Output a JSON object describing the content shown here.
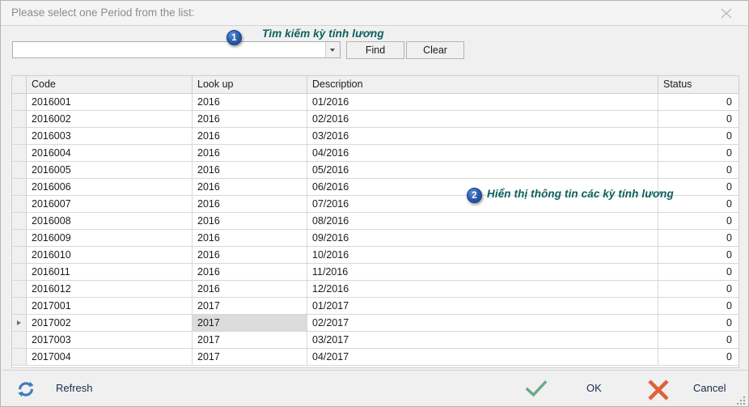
{
  "window": {
    "title": "Please select one Period from the list:",
    "close_icon": "close-icon"
  },
  "search": {
    "value": "",
    "placeholder": "",
    "dropdown_icon": "chevron-down-icon",
    "find_label": "Find",
    "clear_label": "Clear"
  },
  "annotations": [
    {
      "number": "1",
      "text": "Tìm kiếm kỳ tính lương"
    },
    {
      "number": "2",
      "text": "Hiển thị thông tin các kỳ tính lương"
    }
  ],
  "grid": {
    "columns": [
      "Code",
      "Look up",
      "Description",
      "Status"
    ],
    "current_row_index": 13,
    "rows": [
      {
        "code": "2016001",
        "lookup": "2016",
        "description": "01/2016",
        "status": "0"
      },
      {
        "code": "2016002",
        "lookup": "2016",
        "description": "02/2016",
        "status": "0"
      },
      {
        "code": "2016003",
        "lookup": "2016",
        "description": "03/2016",
        "status": "0"
      },
      {
        "code": "2016004",
        "lookup": "2016",
        "description": "04/2016",
        "status": "0"
      },
      {
        "code": "2016005",
        "lookup": "2016",
        "description": "05/2016",
        "status": "0"
      },
      {
        "code": "2016006",
        "lookup": "2016",
        "description": "06/2016",
        "status": "0"
      },
      {
        "code": "2016007",
        "lookup": "2016",
        "description": "07/2016",
        "status": "0"
      },
      {
        "code": "2016008",
        "lookup": "2016",
        "description": "08/2016",
        "status": "0"
      },
      {
        "code": "2016009",
        "lookup": "2016",
        "description": "09/2016",
        "status": "0"
      },
      {
        "code": "2016010",
        "lookup": "2016",
        "description": "10/2016",
        "status": "0"
      },
      {
        "code": "2016011",
        "lookup": "2016",
        "description": "11/2016",
        "status": "0"
      },
      {
        "code": "2016012",
        "lookup": "2016",
        "description": "12/2016",
        "status": "0"
      },
      {
        "code": "2017001",
        "lookup": "2017",
        "description": "01/2017",
        "status": "0"
      },
      {
        "code": "2017002",
        "lookup": "2017",
        "description": "02/2017",
        "status": "0"
      },
      {
        "code": "2017003",
        "lookup": "2017",
        "description": "03/2017",
        "status": "0"
      },
      {
        "code": "2017004",
        "lookup": "2017",
        "description": "04/2017",
        "status": "0"
      }
    ]
  },
  "footer": {
    "refresh_label": "Refresh",
    "refresh_icon": "refresh-icon",
    "ok_label": "OK",
    "ok_icon": "check-icon",
    "cancel_label": "Cancel",
    "cancel_icon": "x-icon"
  },
  "colors": {
    "annotation": "#0d5f5f",
    "badge": "#2a5fb0",
    "ok": "#6aa98b",
    "cancel": "#e0603c",
    "refresh": "#3f7bbd"
  }
}
